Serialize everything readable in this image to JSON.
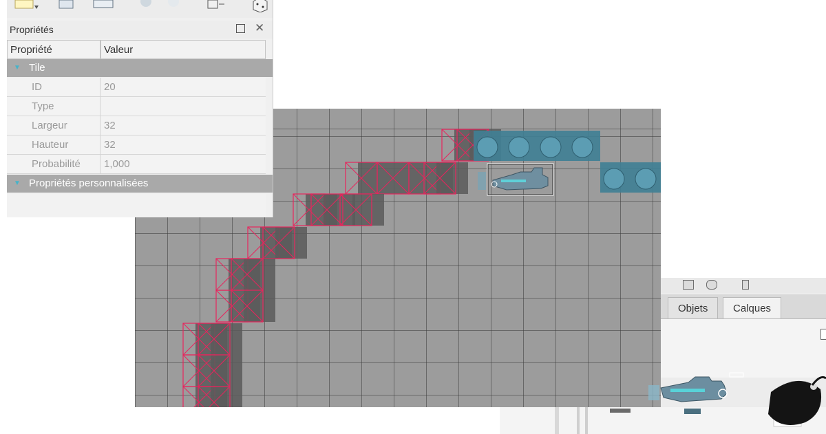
{
  "properties_panel": {
    "title": "Propriétés",
    "columns": {
      "property": "Propriété",
      "value": "Valeur"
    },
    "groups": {
      "tile": "Tile",
      "custom": "Propriétés personnalisées"
    },
    "rows": [
      {
        "name": "ID",
        "value": "20"
      },
      {
        "name": "Type",
        "value": ""
      },
      {
        "name": "Largeur",
        "value": "32"
      },
      {
        "name": "Hauteur",
        "value": "32"
      },
      {
        "name": "Probabilité",
        "value": "1,000"
      }
    ]
  },
  "side_window": {
    "tabs": [
      {
        "label": "Objets",
        "active": false
      },
      {
        "label": "Calques",
        "active": true
      }
    ]
  },
  "icons": {
    "panel_float": "float-icon",
    "panel_close": "close-icon",
    "group_expand": "expand-arrow-icon",
    "toolbar_new": "new-map-icon",
    "toolbar_save": "save-icon",
    "toolbar_dice": "random-dice-icon"
  },
  "colors": {
    "collision": "#e8245d",
    "tile_dark": "#5a5a5a",
    "tile_blue": "#3f7f95",
    "canvas": "#9c9c9c"
  }
}
